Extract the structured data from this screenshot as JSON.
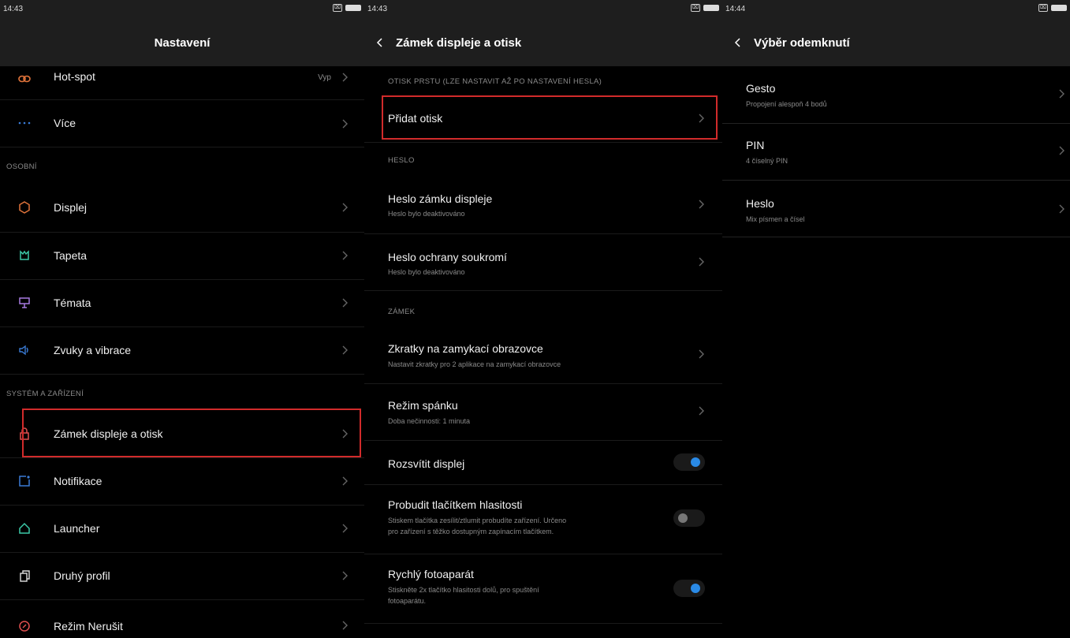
{
  "panel1": {
    "status": {
      "time": "14:43",
      "sim": "⌧"
    },
    "title": "Nastavení",
    "rows": [
      {
        "label": "Hot-spot",
        "value": "Vyp",
        "icon": "hotspot-icon"
      },
      {
        "label": "Více",
        "icon": "more-dots-icon"
      }
    ],
    "section_personal": "OSOBNÍ",
    "personal": [
      {
        "label": "Displej",
        "icon": "display-icon"
      },
      {
        "label": "Tapeta",
        "icon": "wallpaper-icon"
      },
      {
        "label": "Témata",
        "icon": "themes-icon"
      },
      {
        "label": "Zvuky a vibrace",
        "icon": "sound-icon"
      }
    ],
    "section_system": "SYSTÉM A ZAŘÍZENÍ",
    "system": [
      {
        "label": "Zámek displeje a otisk",
        "icon": "lock-icon"
      },
      {
        "label": "Notifikace",
        "icon": "notification-icon"
      },
      {
        "label": "Launcher",
        "icon": "home-icon"
      },
      {
        "label": "Druhý profil",
        "icon": "second-profile-icon"
      },
      {
        "label": "Režim Nerušit",
        "icon": "do-not-disturb-icon"
      }
    ]
  },
  "panel2": {
    "status": {
      "time": "14:43",
      "sim": "⌧"
    },
    "title": "Zámek displeje a otisk",
    "section_fingerprint": "OTISK PRSTU (LZE NASTAVIT AŽ PO NASTAVENÍ HESLA)",
    "add_fingerprint": "Přidat otisk",
    "section_password": "HESLO",
    "password_rows": [
      {
        "label": "Heslo zámku displeje",
        "sub": "Heslo bylo deaktivováno"
      },
      {
        "label": "Heslo ochrany soukromí",
        "sub": "Heslo bylo deaktivováno"
      }
    ],
    "section_lock": "ZÁMEK",
    "lock_rows": [
      {
        "label": "Zkratky na zamykací obrazovce",
        "sub": "Nastavit zkratky pro 2 aplikace na zamykací obrazovce"
      },
      {
        "label": "Režim spánku",
        "sub": "Doba nečinnosti: 1 minuta"
      }
    ],
    "toggles": [
      {
        "label": "Rozsvítit displej",
        "sub": "",
        "on": true
      },
      {
        "label": "Probudit tlačítkem hlasitosti",
        "sub1": "Stiskem tlačítka zesílit/ztlumit probudíte zařízení. Určeno",
        "sub2": "pro zařízení s těžko dostupným zapínacím tlačítkem.",
        "on": false
      },
      {
        "label": "Rychlý fotoaparát",
        "sub1": "Stiskněte 2x tlačítko hlasitosti dolů, pro spuštění",
        "sub2": "fotoaparátu.",
        "on": true
      }
    ]
  },
  "panel3": {
    "status": {
      "time": "14:44",
      "sim": "⌧"
    },
    "title": "Výběr odemknutí",
    "rows": [
      {
        "label": "Gesto",
        "sub": "Propojení alespoň 4 bodů"
      },
      {
        "label": "PIN",
        "sub": "4 číselný PIN"
      },
      {
        "label": "Heslo",
        "sub": "Mix písmen a čísel"
      }
    ]
  },
  "colors": {
    "accent": "#2a8ae6",
    "highlight": "#d12b2b",
    "header": "#1e1e1e"
  }
}
